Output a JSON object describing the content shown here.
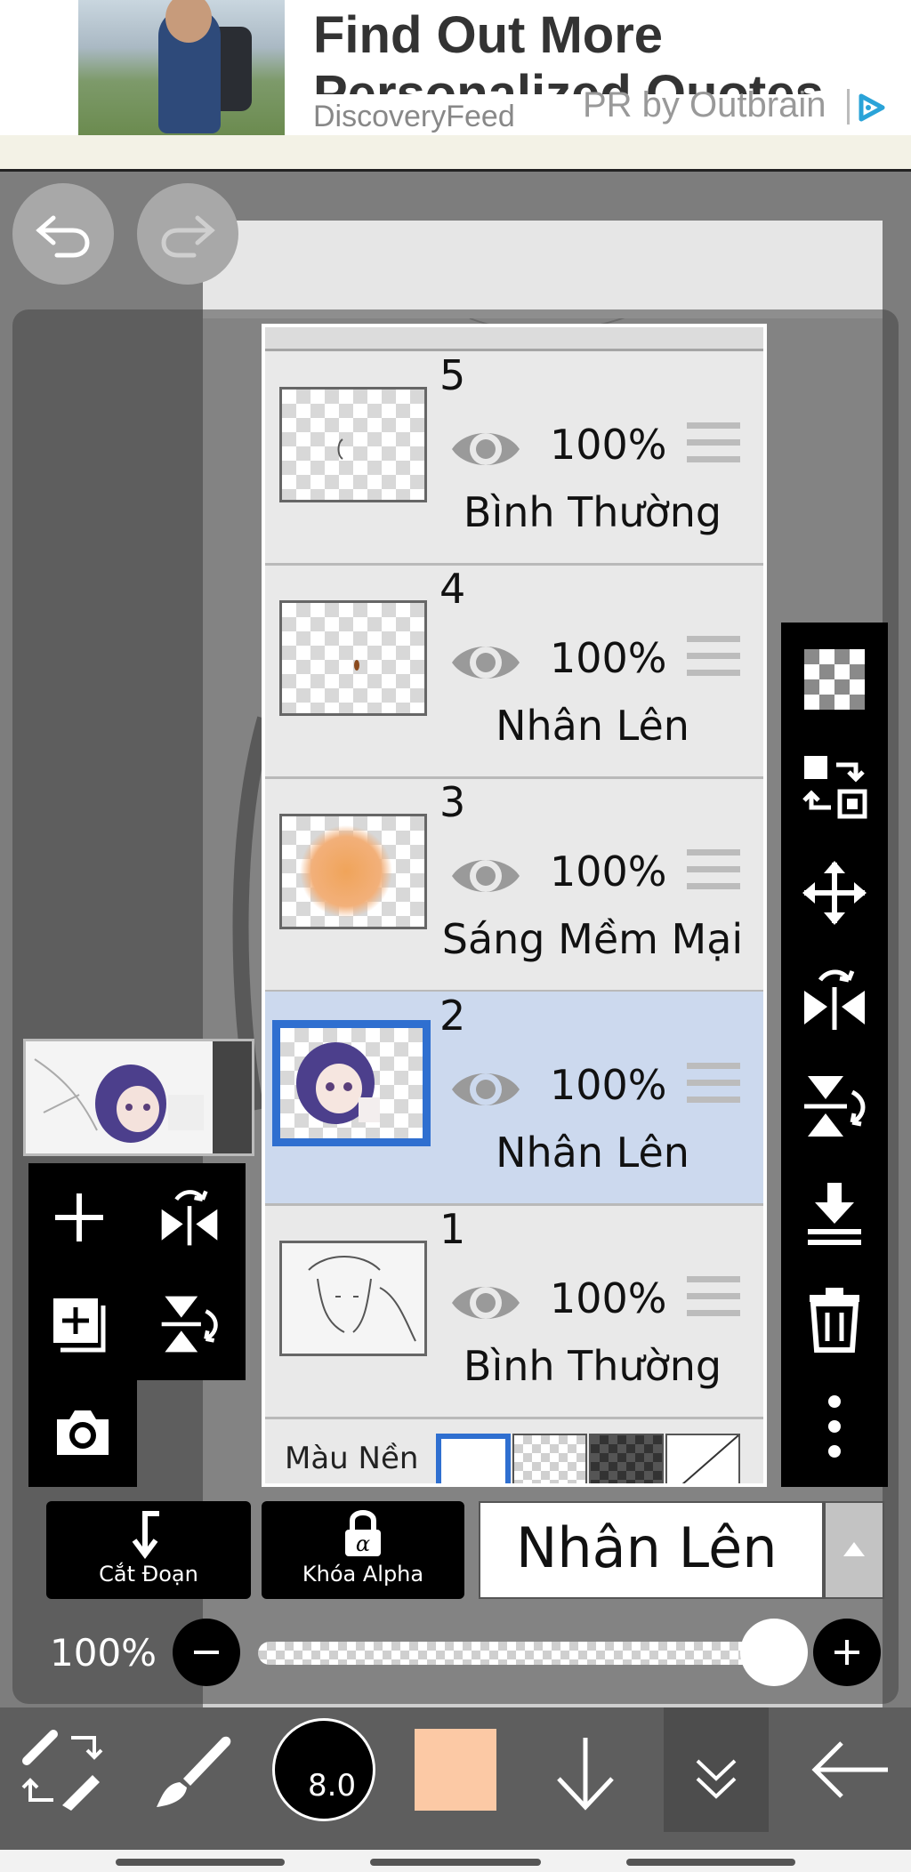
{
  "ad": {
    "title": "Find Out More",
    "title_line2": "Personalized Quotes",
    "source": "DiscoveryFeed",
    "sponsor": "PR by Outbrain"
  },
  "layers": [
    {
      "number": "5",
      "opacity": "100%",
      "blend": "Bình Thường",
      "selected": false
    },
    {
      "number": "4",
      "opacity": "100%",
      "blend": "Nhân Lên",
      "selected": false
    },
    {
      "number": "3",
      "opacity": "100%",
      "blend": "Sáng Mềm Mại",
      "selected": false
    },
    {
      "number": "2",
      "opacity": "100%",
      "blend": "Nhân Lên",
      "selected": true
    },
    {
      "number": "1",
      "opacity": "100%",
      "blend": "Bình Thường",
      "selected": false
    }
  ],
  "background_label": "Màu Nền",
  "buttons": {
    "clip": "Cắt Đoạn",
    "alpha_lock": "Khóa Alpha"
  },
  "blend_mode_selected": "Nhân Lên",
  "layer_opacity": "100%",
  "layer_opacity_value": 1.0,
  "brush_size": "8.0",
  "colors": {
    "current_color": "#fcc9a5",
    "selection": "#2f6fd0",
    "selected_row": "#ccd9ee"
  },
  "icons": {
    "right_toolbar": [
      "transparency-icon",
      "swap-layer-icon",
      "move-icon",
      "flip-horizontal-icon",
      "flip-vertical-icon",
      "merge-down-icon",
      "trash-icon",
      "more-icon"
    ],
    "left_toolbar": [
      "add-layer-icon",
      "flip-horizontal-icon",
      "duplicate-layer-icon",
      "flip-vertical-icon",
      "camera-icon"
    ],
    "bottom_toolbar": [
      "transform-tool-icon",
      "brush-icon",
      "brush-size",
      "color-swatch",
      "arrow-down-icon",
      "collapse-icon",
      "back-arrow-icon"
    ]
  }
}
